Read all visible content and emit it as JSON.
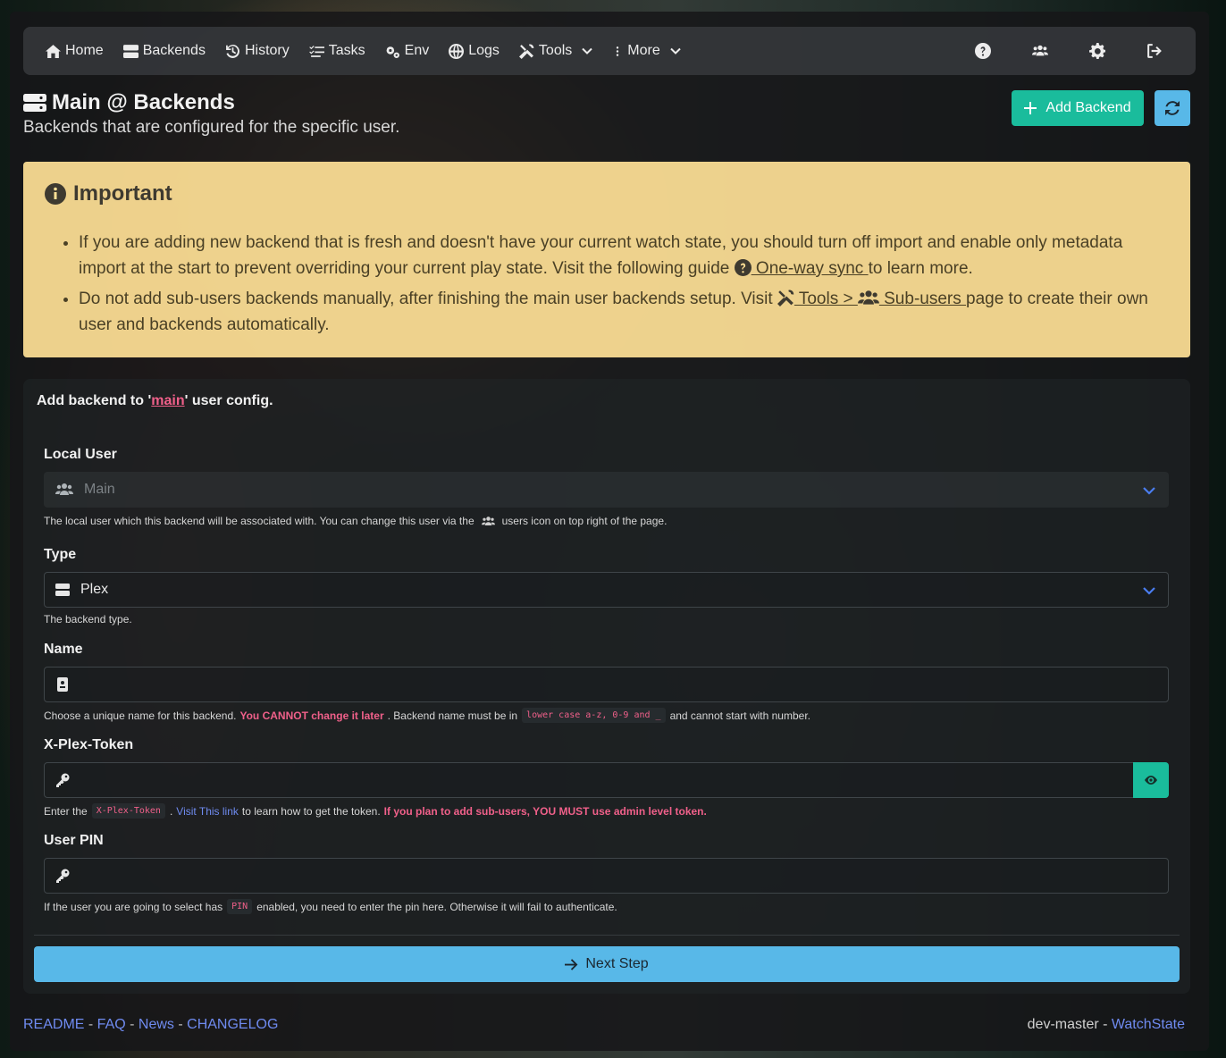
{
  "nav": {
    "home": "Home",
    "backends": "Backends",
    "history": "History",
    "tasks": "Tasks",
    "env": "Env",
    "logs": "Logs",
    "tools": "Tools",
    "more": "More"
  },
  "header": {
    "title": "Main @ Backends",
    "subtitle": "Backends that are configured for the specific user.",
    "add_button": "Add Backend"
  },
  "important": {
    "title": "Important",
    "item1_text_a": "If you are adding new backend that is fresh and doesn't have your current watch state, you should turn off import and enable only metadata import at the start to prevent overriding your current play state. Visit the following guide",
    "item1_link": " One-way sync ",
    "item1_text_b": "to learn more.",
    "item2_text_a": "Do not add sub-users backends manually, after finishing the main user backends setup. Visit",
    "item2_link_a": " Tools > ",
    "item2_link_b": " Sub-users ",
    "item2_text_b": "page to create their own user and backends automatically."
  },
  "form": {
    "heading_a": "Add backend to '",
    "heading_user": "main",
    "heading_b": "' user config.",
    "local_user": {
      "label": "Local User",
      "value": "Main",
      "help_a": "The local user which this backend will be associated with. You can change this user via the",
      "help_b": "users icon on top right of the page."
    },
    "type": {
      "label": "Type",
      "value": "Plex",
      "help": "The backend type."
    },
    "name": {
      "label": "Name",
      "value": "",
      "help_a": "Choose a unique name for this backend.",
      "help_warn": "You CANNOT change it later",
      "help_b": ". Backend name must be in",
      "help_code": "lower case a-z, 0-9 and _",
      "help_c": "and cannot start with number."
    },
    "token": {
      "label": "X-Plex-Token",
      "value": "",
      "help_a": "Enter the",
      "help_code": "X-Plex-Token",
      "help_b": ".",
      "help_link": "Visit This link",
      "help_c": "to learn how to get the token.",
      "help_warn": "If you plan to add sub-users, YOU MUST use admin level token."
    },
    "pin": {
      "label": "User PIN",
      "value": "",
      "help_a": "If the user you are going to select has",
      "help_code": "PIN",
      "help_b": "enabled, you need to enter the pin here. Otherwise it will fail to authenticate."
    },
    "next_button": "Next Step"
  },
  "footer": {
    "readme": "README",
    "faq": "FAQ",
    "news": "News",
    "changelog": "CHANGELOG",
    "sep": " - ",
    "version": "dev-master",
    "app": "WatchState"
  },
  "colors": {
    "accent_teal": "#1abc9c",
    "accent_blue": "#58b8e8",
    "warning_bg": "#fee096",
    "danger_text": "#f0608a",
    "link": "#6f8bf0"
  }
}
